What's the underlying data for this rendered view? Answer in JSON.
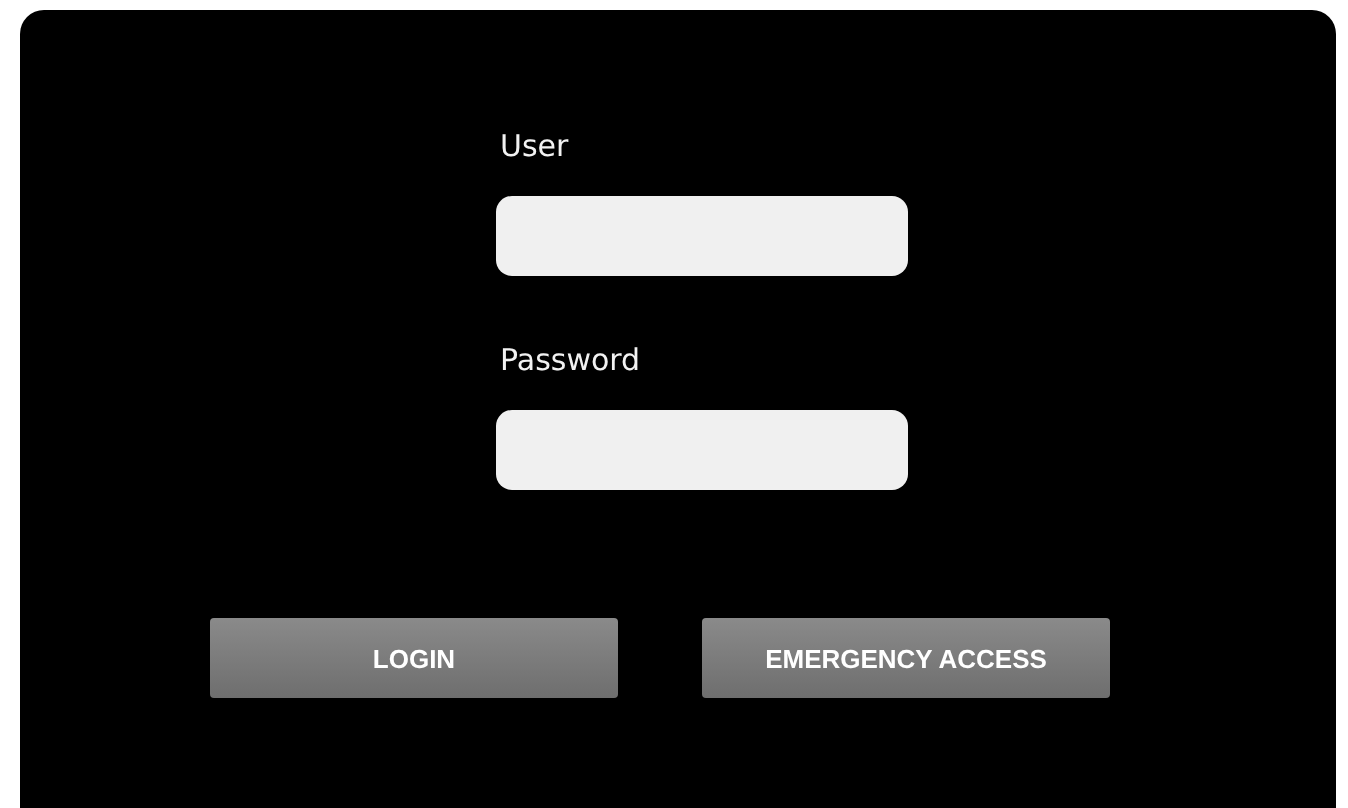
{
  "fields": [
    {
      "label": "User"
    },
    {
      "label": "Password"
    }
  ],
  "buttons": [
    "LOGIN",
    "EMERGENCY ACCESS"
  ]
}
